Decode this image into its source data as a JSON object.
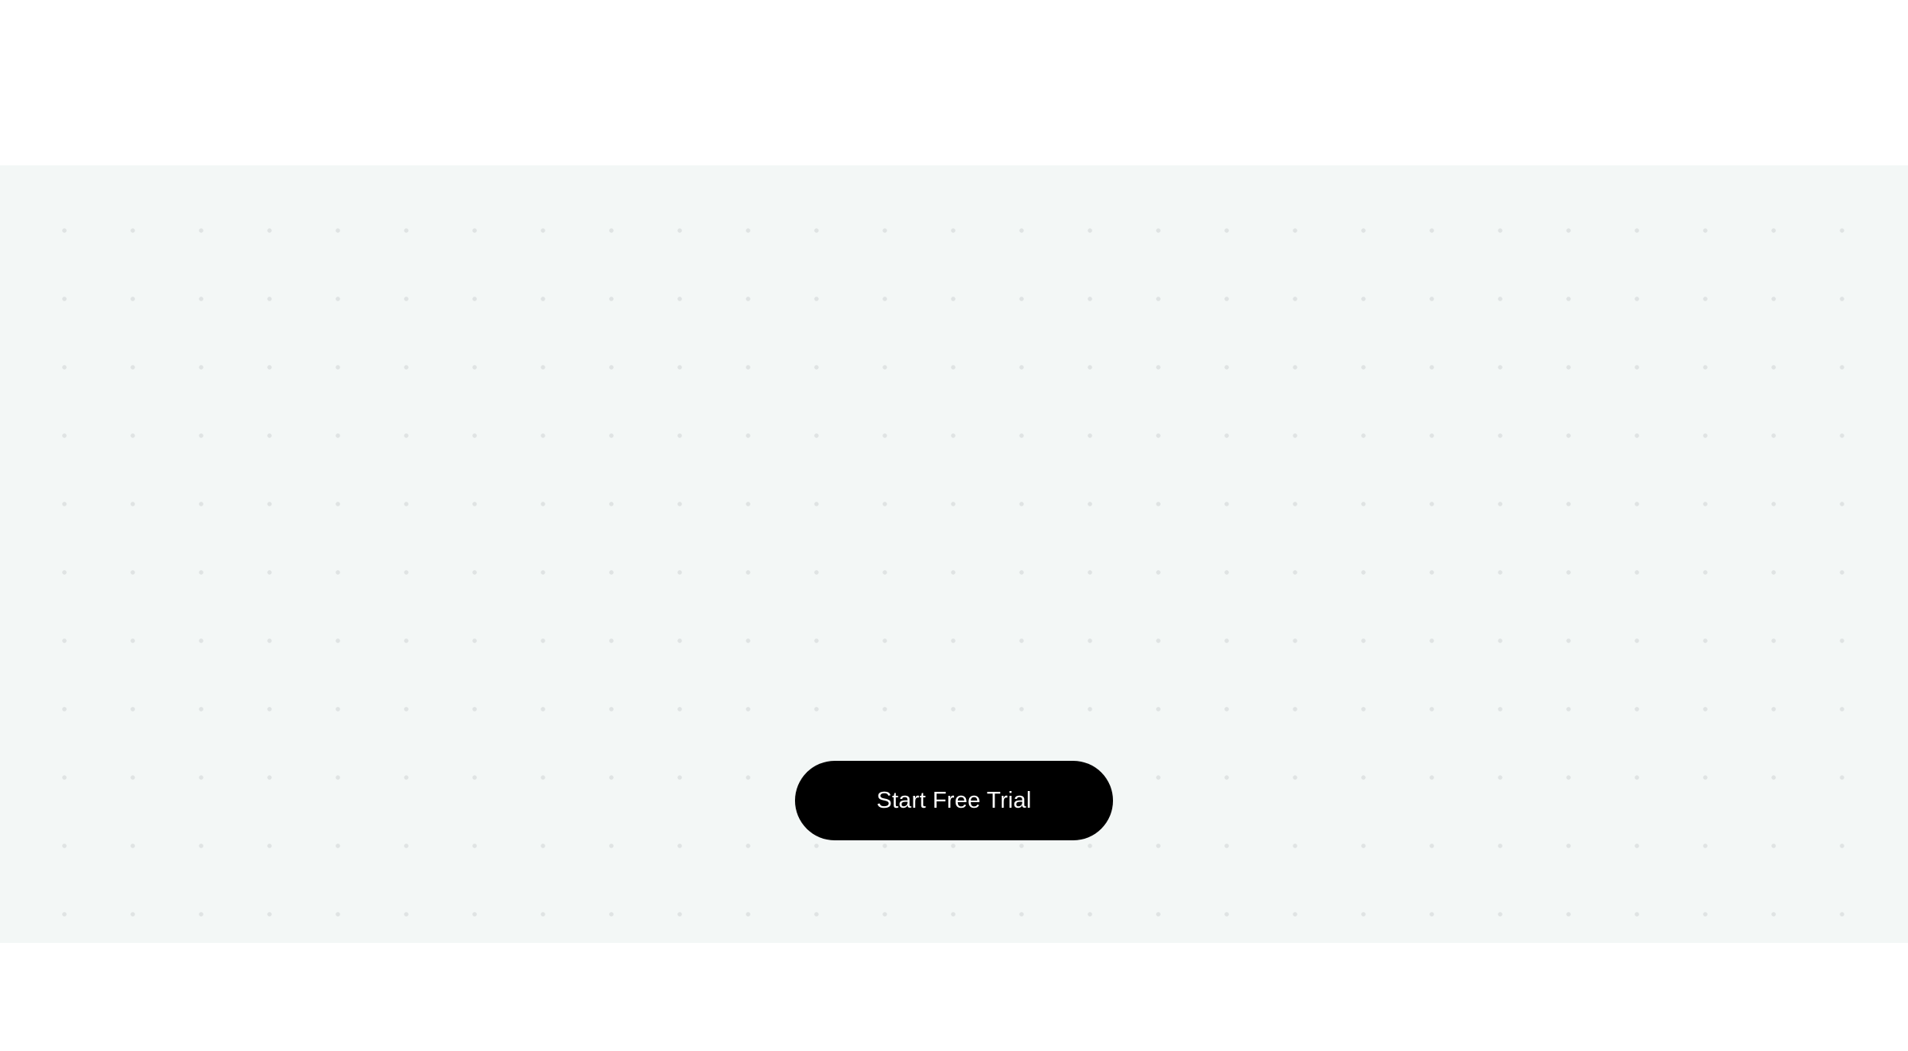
{
  "cta_section": {
    "background_color": "#F3F7F6",
    "dot_color": "#DFE3E3",
    "button": {
      "label": "Start Free Trial",
      "background_color": "#000000",
      "text_color": "#FFFFFF"
    }
  }
}
